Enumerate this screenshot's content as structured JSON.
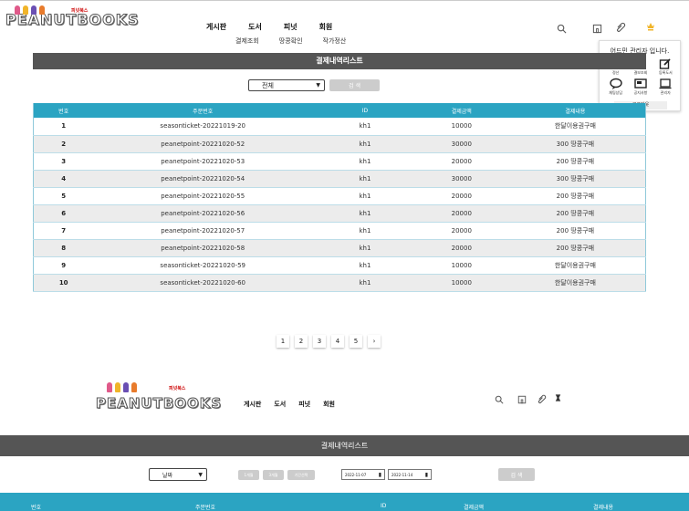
{
  "brand": {
    "logo_text": "PEANUTBOOKS",
    "logo_tag": "피넛북스"
  },
  "nav": {
    "items": [
      "게시판",
      "도서",
      "피넛",
      "회원"
    ]
  },
  "subnav": {
    "items": [
      "결제조회",
      "땅콩확인",
      "작가정산"
    ]
  },
  "admin_menu": {
    "greeting": "어드민 관리자 입니다.",
    "items": [
      "정산",
      "결보조회",
      "등록도서",
      "채팅상담",
      "공지사항",
      "관리자"
    ],
    "logout": "로그아웃"
  },
  "page": {
    "title": "결제내역리스트",
    "filter_value": "전체",
    "search_label": "검 색"
  },
  "table": {
    "headers": [
      "번호",
      "주문번호",
      "ID",
      "결제금액",
      "결제내용"
    ],
    "rows": [
      [
        "1",
        "seasonticket-20221019-20",
        "kh1",
        "10000",
        "한달이용권구매"
      ],
      [
        "2",
        "peanetpoint-20221020-52",
        "kh1",
        "30000",
        "300 땅콩구매"
      ],
      [
        "3",
        "peanetpoint-20221020-53",
        "kh1",
        "20000",
        "200 땅콩구매"
      ],
      [
        "4",
        "peanetpoint-20221020-54",
        "kh1",
        "30000",
        "300 땅콩구매"
      ],
      [
        "5",
        "peanetpoint-20221020-55",
        "kh1",
        "20000",
        "200 땅콩구매"
      ],
      [
        "6",
        "peanetpoint-20221020-56",
        "kh1",
        "20000",
        "200 땅콩구매"
      ],
      [
        "7",
        "peanetpoint-20221020-57",
        "kh1",
        "20000",
        "200 땅콩구매"
      ],
      [
        "8",
        "peanetpoint-20221020-58",
        "kh1",
        "20000",
        "200 땅콩구매"
      ],
      [
        "9",
        "seasonticket-20221020-59",
        "kh1",
        "10000",
        "한달이용권구매"
      ],
      [
        "10",
        "seasonticket-20221020-60",
        "kh1",
        "10000",
        "한달이용권구매"
      ]
    ]
  },
  "pagination": {
    "pages": [
      "1",
      "2",
      "3",
      "4",
      "5"
    ],
    "next": "›"
  },
  "second": {
    "title": "결제내역리스트",
    "filter_value": "날짜",
    "range_buttons": [
      "1개월",
      "3개월",
      "기간선택"
    ],
    "date_from": "2022-11-07",
    "date_to": "2022-11-14",
    "search_label": "검 색",
    "headers": [
      "번호",
      "주문번호",
      "ID",
      "결제금액",
      "결제내용"
    ]
  },
  "colors": {
    "accent": "#2ba4c2",
    "bar": "#555555",
    "stripe": "#ececec"
  }
}
